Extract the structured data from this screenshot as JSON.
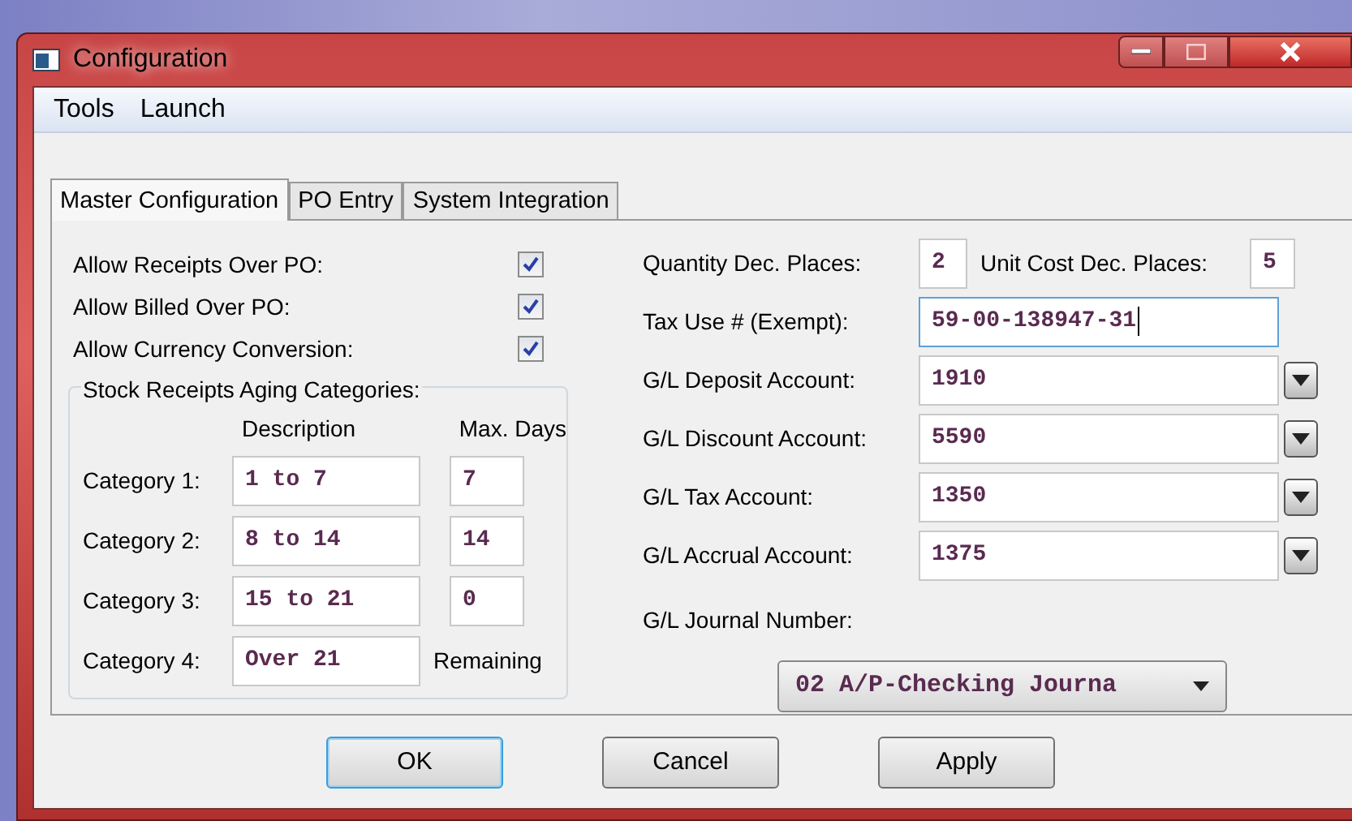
{
  "window": {
    "title": "Configuration"
  },
  "menu": [
    "Tools",
    "Launch"
  ],
  "tabs": [
    {
      "label": "Master Configuration",
      "selected": true
    },
    {
      "label": "PO Entry",
      "selected": false
    },
    {
      "label": "System Integration",
      "selected": false
    }
  ],
  "options": [
    {
      "label": "Allow Receipts Over PO:",
      "checked": true
    },
    {
      "label": "Allow Billed Over PO:",
      "checked": true
    },
    {
      "label": "Allow Currency Conversion:",
      "checked": true
    }
  ],
  "aging_group": {
    "title": "Stock Receipts Aging Categories:",
    "columns": [
      "Description",
      "Max. Days"
    ],
    "rows": [
      {
        "label": "Category 1:",
        "description": "1 to 7",
        "max_days": "7"
      },
      {
        "label": "Category 2:",
        "description": "8 to 14",
        "max_days": "14"
      },
      {
        "label": "Category 3:",
        "description": "15 to 21",
        "max_days": "0"
      },
      {
        "label": "Category 4:",
        "description": "Over 21",
        "note": "Remaining"
      }
    ]
  },
  "decimals": [
    {
      "label": "Quantity Dec. Places:",
      "value": "2"
    },
    {
      "label": "Unit Cost Dec. Places:",
      "value": "5"
    }
  ],
  "tax_use": {
    "label": "Tax Use # (Exempt):",
    "value": "59-00-138947-31",
    "focused": true
  },
  "accounts": [
    {
      "label": "G/L Deposit Account:",
      "value": "1910"
    },
    {
      "label": "G/L Discount Account:",
      "value": "5590"
    },
    {
      "label": "G/L Tax Account:",
      "value": "1350"
    },
    {
      "label": "G/L Accrual Account:",
      "value": "1375"
    }
  ],
  "journal": {
    "label": "G/L Journal Number:",
    "value": "02 A/P-Checking Journa"
  },
  "buttons": [
    {
      "label": "OK",
      "default": true
    },
    {
      "label": "Cancel",
      "default": false
    },
    {
      "label": "Apply",
      "default": false
    }
  ]
}
